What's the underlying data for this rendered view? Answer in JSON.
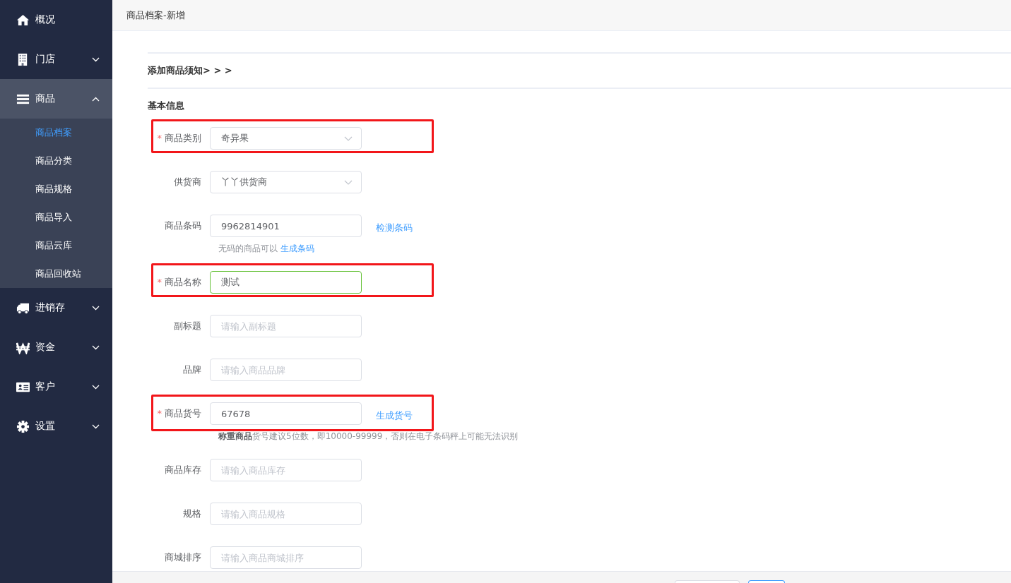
{
  "sidebar": {
    "items": [
      {
        "label": "概况",
        "selected": false
      },
      {
        "label": "门店",
        "selected": false,
        "expanded": false
      },
      {
        "label": "商品",
        "selected": true,
        "expanded": true,
        "children": [
          {
            "label": "商品档案",
            "selected": true
          },
          {
            "label": "商品分类",
            "selected": false
          },
          {
            "label": "商品规格",
            "selected": false
          },
          {
            "label": "商品导入",
            "selected": false
          },
          {
            "label": "商品云库",
            "selected": false
          },
          {
            "label": "商品回收站",
            "selected": false
          }
        ]
      },
      {
        "label": "进销存",
        "selected": false,
        "expanded": false
      },
      {
        "label": "资金",
        "selected": false,
        "expanded": false
      },
      {
        "label": "客户",
        "selected": false,
        "expanded": false
      },
      {
        "label": "设置",
        "selected": false,
        "expanded": false
      }
    ]
  },
  "header": {
    "title": "商品档案-新增"
  },
  "notice": "添加商品须知> > >",
  "section_title": "基本信息",
  "fields": [
    {
      "label": "商品类别",
      "kind": "select",
      "required_mark": "*",
      "highlighted": true,
      "value": "奇异果"
    },
    {
      "label": "供货商",
      "kind": "select",
      "highlighted": false,
      "value": "丫丫供货商"
    },
    {
      "label": "商品条码",
      "kind": "input",
      "highlighted": false,
      "focused": false,
      "value": "9962814901",
      "link": "检测条码",
      "hint": "无码的商品可以",
      "hint_link": "生成条码"
    },
    {
      "label": "商品名称",
      "kind": "input",
      "required_mark": "*",
      "highlighted": true,
      "focused": true,
      "value": "测试"
    },
    {
      "label": "副标题",
      "kind": "input",
      "highlighted": false,
      "focused": false,
      "placeholder": "请输入副标题"
    },
    {
      "label": "品牌",
      "kind": "input",
      "highlighted": false,
      "focused": false,
      "placeholder": "请输入商品品牌"
    },
    {
      "label": "商品货号",
      "kind": "input",
      "required_mark": "*",
      "highlighted": true,
      "focused": false,
      "value": "67678",
      "link": "生成货号",
      "hint": "**称重商品**货号建议5位数，即10000-99999，否则在电子条码秤上可能无法识别"
    },
    {
      "label": "商品库存",
      "kind": "input",
      "highlighted": false,
      "focused": false,
      "placeholder": "请输入商品库存"
    },
    {
      "label": "规格",
      "kind": "input",
      "highlighted": false,
      "focused": false,
      "placeholder": "请输入商品规格"
    },
    {
      "label": "商城排序",
      "kind": "input",
      "highlighted": false,
      "focused": false,
      "placeholder": "请输入商品商城排序"
    }
  ]
}
